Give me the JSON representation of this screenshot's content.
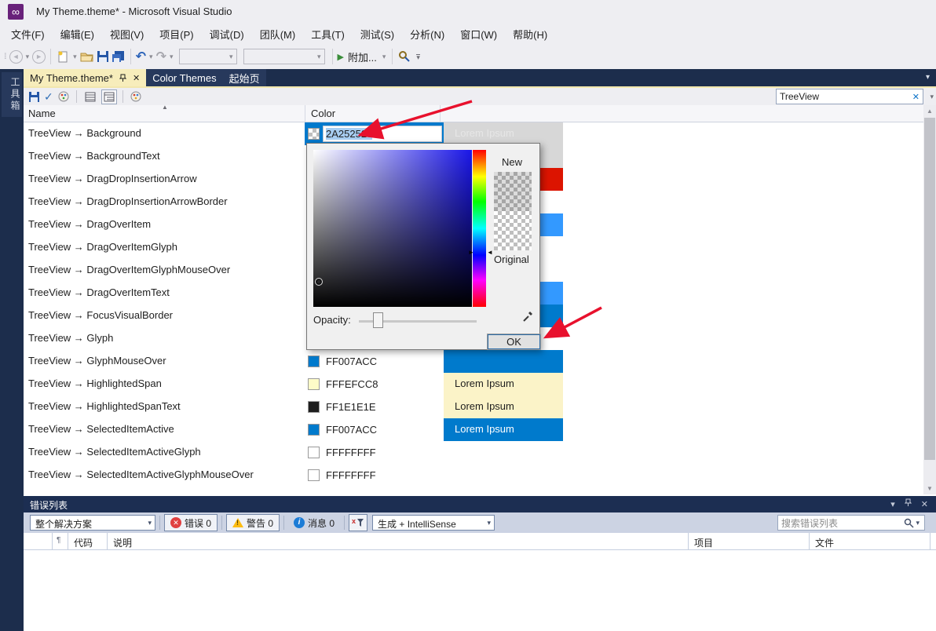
{
  "window": {
    "title": "My Theme.theme* - Microsoft Visual Studio"
  },
  "menu": {
    "items": [
      "文件(F)",
      "编辑(E)",
      "视图(V)",
      "项目(P)",
      "调试(D)",
      "团队(M)",
      "工具(T)",
      "测试(S)",
      "分析(N)",
      "窗口(W)",
      "帮助(H)"
    ]
  },
  "toolbar": {
    "attach_label": "附加..."
  },
  "sidebar": {
    "toolbox_label": "工具箱"
  },
  "icons": {
    "caret_down": "▾",
    "close": "✕",
    "check": "✓",
    "undo": "↶",
    "redo": "↷",
    "play": "▶",
    "sort_asc": "▲",
    "back": "◄",
    "forward": "►",
    "chevron_down": "▾",
    "grip": "⁞⁞",
    "hue_arrow_left": "►",
    "hue_arrow_right": "◄",
    "up": "▲",
    "down": "▼",
    "error_x": "✕",
    "warn_mark": "!",
    "info_i": "i",
    "pin": "⊷",
    "infinity": "∞"
  },
  "editor": {
    "tabs": [
      {
        "label": "My Theme.theme*",
        "active": true
      },
      {
        "label": "Color Themes",
        "active": false
      },
      {
        "label": "起始页",
        "active": false
      }
    ],
    "search": {
      "value": "TreeView"
    },
    "table": {
      "name_header": "Name",
      "color_header": "Color",
      "rows": [
        {
          "name": "TreeView → Background",
          "editing": true,
          "edit_value": "2A252526",
          "preview": {
            "bg": "#d7d7d7",
            "text": "Lorem Ipsum",
            "text_color": "#e6e6e6"
          }
        },
        {
          "name": "TreeView → BackgroundText",
          "preview": {
            "bg": "#d7d7d7"
          }
        },
        {
          "name": "TreeView → DragDropInsertionArrow",
          "preview": {
            "bg": "#dc1400"
          }
        },
        {
          "name": "TreeView → DragDropInsertionArrowBorder",
          "preview": {
            "bg": "#ffffff"
          }
        },
        {
          "name": "TreeView → DragOverItem",
          "preview": {
            "bg": "#3399ff"
          }
        },
        {
          "name": "TreeView → DragOverItemGlyph",
          "preview": {
            "bg": "#ffffff"
          }
        },
        {
          "name": "TreeView → DragOverItemGlyphMouseOver",
          "preview": {
            "bg": "#ffffff"
          }
        },
        {
          "name": "TreeView → DragOverItemText",
          "preview": {
            "bg": "#3399ff"
          }
        },
        {
          "name": "TreeView → FocusVisualBorder",
          "preview": {
            "bg": "#007acc"
          }
        },
        {
          "name": "TreeView → Glyph",
          "preview": {
            "bg": "#ffffff"
          }
        },
        {
          "name": "TreeView → GlyphMouseOver",
          "color_hex": "FF007ACC",
          "swatch": "#007acc",
          "preview": {
            "bg": "#007acc"
          }
        },
        {
          "name": "TreeView → HighlightedSpan",
          "color_hex": "FFFEFCC8",
          "swatch": "#fefcc8",
          "preview": {
            "bg": "#fbf3c8",
            "text": "Lorem Ipsum",
            "text_color": "#1e1e1e"
          }
        },
        {
          "name": "TreeView → HighlightedSpanText",
          "color_hex": "FF1E1E1E",
          "swatch": "#1e1e1e",
          "preview": {
            "bg": "#fbf3c8",
            "text": "Lorem Ipsum",
            "text_color": "#1e1e1e"
          }
        },
        {
          "name": "TreeView → SelectedItemActive",
          "color_hex": "FF007ACC",
          "swatch": "#007acc",
          "preview": {
            "bg": "#007acc",
            "text": "Lorem Ipsum",
            "text_color": "#ffffff"
          }
        },
        {
          "name": "TreeView → SelectedItemActiveGlyph",
          "color_hex": "FFFFFFFF",
          "swatch": "#ffffff",
          "preview": {
            "bg": "#ffffff"
          }
        },
        {
          "name": "TreeView → SelectedItemActiveGlyphMouseOver",
          "color_hex": "FFFFFFFF",
          "swatch": "#ffffff",
          "preview": {
            "bg": "#ffffff"
          }
        }
      ]
    }
  },
  "dialog": {
    "new_label": "New",
    "original_label": "Original",
    "opacity_label": "Opacity:",
    "ok_label": "OK"
  },
  "error_list": {
    "title": "错误列表",
    "scope": "整个解决方案",
    "errors_label": "错误 0",
    "warnings_label": "警告 0",
    "messages_label": "消息 0",
    "source_filter": "生成 + IntelliSense",
    "search_placeholder": "搜索错误列表",
    "columns": [
      "代码",
      "说明",
      "项目",
      "文件"
    ]
  },
  "colors": {
    "accent": "#007acc",
    "active_tab_bg": "#f7edbb",
    "well_bg": "#1c2d4c",
    "annotation": "#e8112d"
  }
}
